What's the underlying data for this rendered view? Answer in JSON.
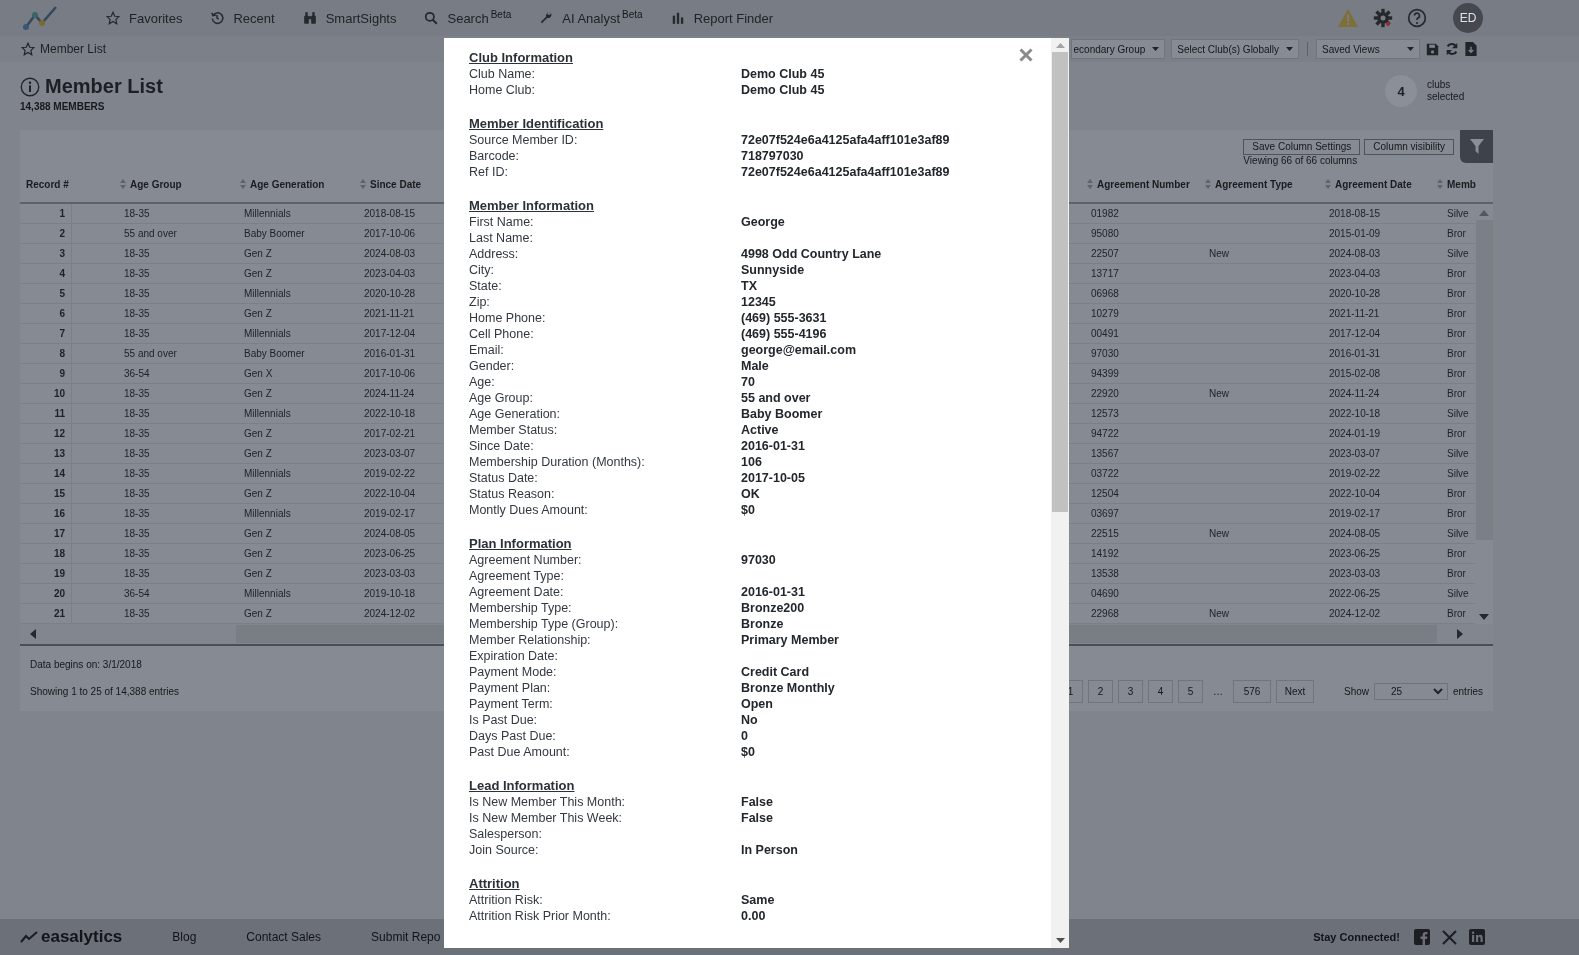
{
  "nav": {
    "items": [
      {
        "label": "Favorites"
      },
      {
        "label": "Recent"
      },
      {
        "label": "SmartSights"
      },
      {
        "label": "Search",
        "badge": "Beta"
      },
      {
        "label": "AI Analyst",
        "badge": "Beta"
      },
      {
        "label": "Report Finder"
      }
    ],
    "avatar": "ED"
  },
  "breadcrumb": "Member List",
  "toolbar": {
    "selects": [
      "econdary Group",
      "Select Club(s) Globally"
    ],
    "saved_views": "Saved Views"
  },
  "page": {
    "title": "Member List",
    "count": "14,388 MEMBERS",
    "clubs_count": "4",
    "clubs_label": "clubs selected"
  },
  "table_tools": {
    "buttons": [
      "Save Column Settings",
      "Column visibility"
    ],
    "note": "Viewing 66 of 66 columns"
  },
  "table": {
    "columns": [
      {
        "label": "Record #",
        "sortable": false
      },
      {
        "label": "Age Group",
        "sortable": true
      },
      {
        "label": "Age Generation",
        "sortable": true
      },
      {
        "label": "Since Date",
        "sortable": true
      },
      {
        "label": "Agreement Number",
        "sortable": true
      },
      {
        "label": "Agreement Type",
        "sortable": true
      },
      {
        "label": "Agreement Date",
        "sortable": true
      },
      {
        "label": "Memb",
        "sortable": true
      }
    ],
    "rows": [
      {
        "record": "1",
        "age_group": "18-35",
        "age_generation": "Millennials",
        "since_date": "2018-08-15",
        "agreement_number": "01982",
        "agreement_date": "2018-08-15",
        "memb": "Silve"
      },
      {
        "record": "2",
        "age_group": "55 and over",
        "age_generation": "Baby Boomer",
        "since_date": "2017-10-06",
        "agreement_number": "95080",
        "agreement_date": "2015-01-09",
        "memb": "Bror"
      },
      {
        "record": "3",
        "age_group": "18-35",
        "age_generation": "Gen Z",
        "since_date": "2024-08-03",
        "agreement_number": "22507",
        "agreement_type": "New",
        "agreement_date": "2024-08-03",
        "memb": "Silve"
      },
      {
        "record": "4",
        "age_group": "18-35",
        "age_generation": "Gen Z",
        "since_date": "2023-04-03",
        "agreement_number": "13717",
        "agreement_date": "2023-04-03",
        "memb": "Bror"
      },
      {
        "record": "5",
        "age_group": "18-35",
        "age_generation": "Millennials",
        "since_date": "2020-10-28",
        "agreement_number": "06968",
        "agreement_date": "2020-10-28",
        "memb": "Bror"
      },
      {
        "record": "6",
        "age_group": "18-35",
        "age_generation": "Gen Z",
        "since_date": "2021-11-21",
        "agreement_number": "10279",
        "agreement_date": "2021-11-21",
        "memb": "Bror"
      },
      {
        "record": "7",
        "age_group": "18-35",
        "age_generation": "Millennials",
        "since_date": "2017-12-04",
        "agreement_number": "00491",
        "agreement_date": "2017-12-04",
        "memb": "Bror"
      },
      {
        "record": "8",
        "age_group": "55 and over",
        "age_generation": "Baby Boomer",
        "since_date": "2016-01-31",
        "agreement_number": "97030",
        "agreement_date": "2016-01-31",
        "memb": "Bror"
      },
      {
        "record": "9",
        "age_group": "36-54",
        "age_generation": "Gen X",
        "since_date": "2017-10-06",
        "agreement_number": "94399",
        "agreement_date": "2015-02-08",
        "memb": "Bror"
      },
      {
        "record": "10",
        "age_group": "18-35",
        "age_generation": "Gen Z",
        "since_date": "2024-11-24",
        "agreement_number": "22920",
        "agreement_type": "New",
        "agreement_date": "2024-11-24",
        "memb": "Bror"
      },
      {
        "record": "11",
        "age_group": "18-35",
        "age_generation": "Millennials",
        "since_date": "2022-10-18",
        "agreement_number": "12573",
        "agreement_date": "2022-10-18",
        "memb": "Silve"
      },
      {
        "record": "12",
        "age_group": "18-35",
        "age_generation": "Gen Z",
        "since_date": "2017-02-21",
        "agreement_number": "94722",
        "agreement_date": "2024-01-19",
        "memb": "Bror"
      },
      {
        "record": "13",
        "age_group": "18-35",
        "age_generation": "Gen Z",
        "since_date": "2023-03-07",
        "agreement_number": "13567",
        "agreement_date": "2023-03-07",
        "memb": "Silve"
      },
      {
        "record": "14",
        "age_group": "18-35",
        "age_generation": "Millennials",
        "since_date": "2019-02-22",
        "agreement_number": "03722",
        "agreement_date": "2019-02-22",
        "memb": "Silve"
      },
      {
        "record": "15",
        "age_group": "18-35",
        "age_generation": "Gen Z",
        "since_date": "2022-10-04",
        "agreement_number": "12504",
        "agreement_date": "2022-10-04",
        "memb": "Bror"
      },
      {
        "record": "16",
        "age_group": "18-35",
        "age_generation": "Millennials",
        "since_date": "2019-02-17",
        "agreement_number": "03697",
        "agreement_date": "2019-02-17",
        "memb": "Bror"
      },
      {
        "record": "17",
        "age_group": "18-35",
        "age_generation": "Gen Z",
        "since_date": "2024-08-05",
        "agreement_number": "22515",
        "agreement_type": "New",
        "agreement_date": "2024-08-05",
        "memb": "Silve"
      },
      {
        "record": "18",
        "age_group": "18-35",
        "age_generation": "Gen Z",
        "since_date": "2023-06-25",
        "agreement_number": "14192",
        "agreement_date": "2023-06-25",
        "memb": "Bror"
      },
      {
        "record": "19",
        "age_group": "18-35",
        "age_generation": "Gen Z",
        "since_date": "2023-03-03",
        "agreement_number": "13538",
        "agreement_date": "2023-03-03",
        "memb": "Bror"
      },
      {
        "record": "20",
        "age_group": "36-54",
        "age_generation": "Millennials",
        "since_date": "2019-10-18",
        "agreement_number": "04690",
        "agreement_date": "2022-06-25",
        "memb": "Silve"
      },
      {
        "record": "21",
        "age_group": "18-35",
        "age_generation": "Gen Z",
        "since_date": "2024-12-02",
        "agreement_number": "22968",
        "agreement_type": "New",
        "agreement_date": "2024-12-02",
        "memb": "Bror"
      }
    ]
  },
  "table_footer": {
    "data_note": "Data begins on: 3/1/2018",
    "showing": "Showing 1 to 25 of 14,388 entries",
    "pages": [
      "1",
      "2",
      "3",
      "4",
      "5"
    ],
    "ellipsis": "…",
    "last_page": "576",
    "next": "Next",
    "show_label": "Show",
    "page_size": "25",
    "entries_label": "entries"
  },
  "footer": {
    "brand": "easalytics",
    "links": [
      "Blog",
      "Contact Sales",
      "Submit Repo"
    ],
    "social_label": "Stay Connected!"
  },
  "modal": {
    "sections": [
      {
        "title": "Club Information",
        "fields": [
          {
            "label": "Club Name:",
            "value": "Demo Club 45"
          },
          {
            "label": "Home Club:",
            "value": "Demo Club 45"
          }
        ]
      },
      {
        "title": "Member Identification",
        "fields": [
          {
            "label": "Source Member ID:",
            "value": "72e07f524e6a4125afa4aff101e3af89"
          },
          {
            "label": "Barcode:",
            "value": "718797030"
          },
          {
            "label": "Ref ID:",
            "value": "72e07f524e6a4125afa4aff101e3af89"
          }
        ]
      },
      {
        "title": "Member Information",
        "fields": [
          {
            "label": "First Name:",
            "value": "George"
          },
          {
            "label": "Last Name:"
          },
          {
            "label": "Address:",
            "value": "4998 Odd Country Lane"
          },
          {
            "label": "City:",
            "value": "Sunnyside"
          },
          {
            "label": "State:",
            "value": "TX"
          },
          {
            "label": "Zip:",
            "value": "12345"
          },
          {
            "label": "Home Phone:",
            "value": "(469) 555-3631"
          },
          {
            "label": "Cell Phone:",
            "value": "(469) 555-4196"
          },
          {
            "label": "Email:",
            "value": "george@email.com"
          },
          {
            "label": "Gender:",
            "value": "Male"
          },
          {
            "label": "Age:",
            "value": "70"
          },
          {
            "label": "Age Group:",
            "value": "55 and over"
          },
          {
            "label": "Age Generation:",
            "value": "Baby Boomer"
          },
          {
            "label": "Member Status:",
            "value": "Active"
          },
          {
            "label": "Since Date:",
            "value": "2016-01-31"
          },
          {
            "label": "Membership Duration (Months):",
            "value": "106"
          },
          {
            "label": "Status Date:",
            "value": "2017-10-05"
          },
          {
            "label": "Status Reason:",
            "value": "OK"
          },
          {
            "label": "Montly Dues Amount:",
            "value": "$0"
          }
        ]
      },
      {
        "title": "Plan Information",
        "fields": [
          {
            "label": "Agreement Number:",
            "value": "97030"
          },
          {
            "label": "Agreement Type:"
          },
          {
            "label": "Agreement Date:",
            "value": "2016-01-31"
          },
          {
            "label": "Membership Type:",
            "value": "Bronze200"
          },
          {
            "label": "Membership Type (Group):",
            "value": "Bronze"
          },
          {
            "label": "Member Relationship:",
            "value": "Primary Member"
          },
          {
            "label": "Expiration Date:"
          },
          {
            "label": "Payment Mode:",
            "value": "Credit Card"
          },
          {
            "label": "Payment Plan:",
            "value": "Bronze Monthly"
          },
          {
            "label": "Payment Term:",
            "value": "Open"
          },
          {
            "label": "Is Past Due:",
            "value": "No"
          },
          {
            "label": "Days Past Due:",
            "value": "0"
          },
          {
            "label": "Past Due Amount:",
            "value": "$0"
          }
        ]
      },
      {
        "title": "Lead Information",
        "fields": [
          {
            "label": "Is New Member This Month:",
            "value": "False"
          },
          {
            "label": "Is New Member This Week:",
            "value": "False"
          },
          {
            "label": "Salesperson:"
          },
          {
            "label": "Join Source:",
            "value": "In Person"
          }
        ]
      },
      {
        "title": "Attrition",
        "fields": [
          {
            "label": "Attrition Risk:",
            "value": "Same"
          },
          {
            "label": "Attrition Risk Prior Month:",
            "value": "0.00"
          }
        ]
      }
    ]
  }
}
